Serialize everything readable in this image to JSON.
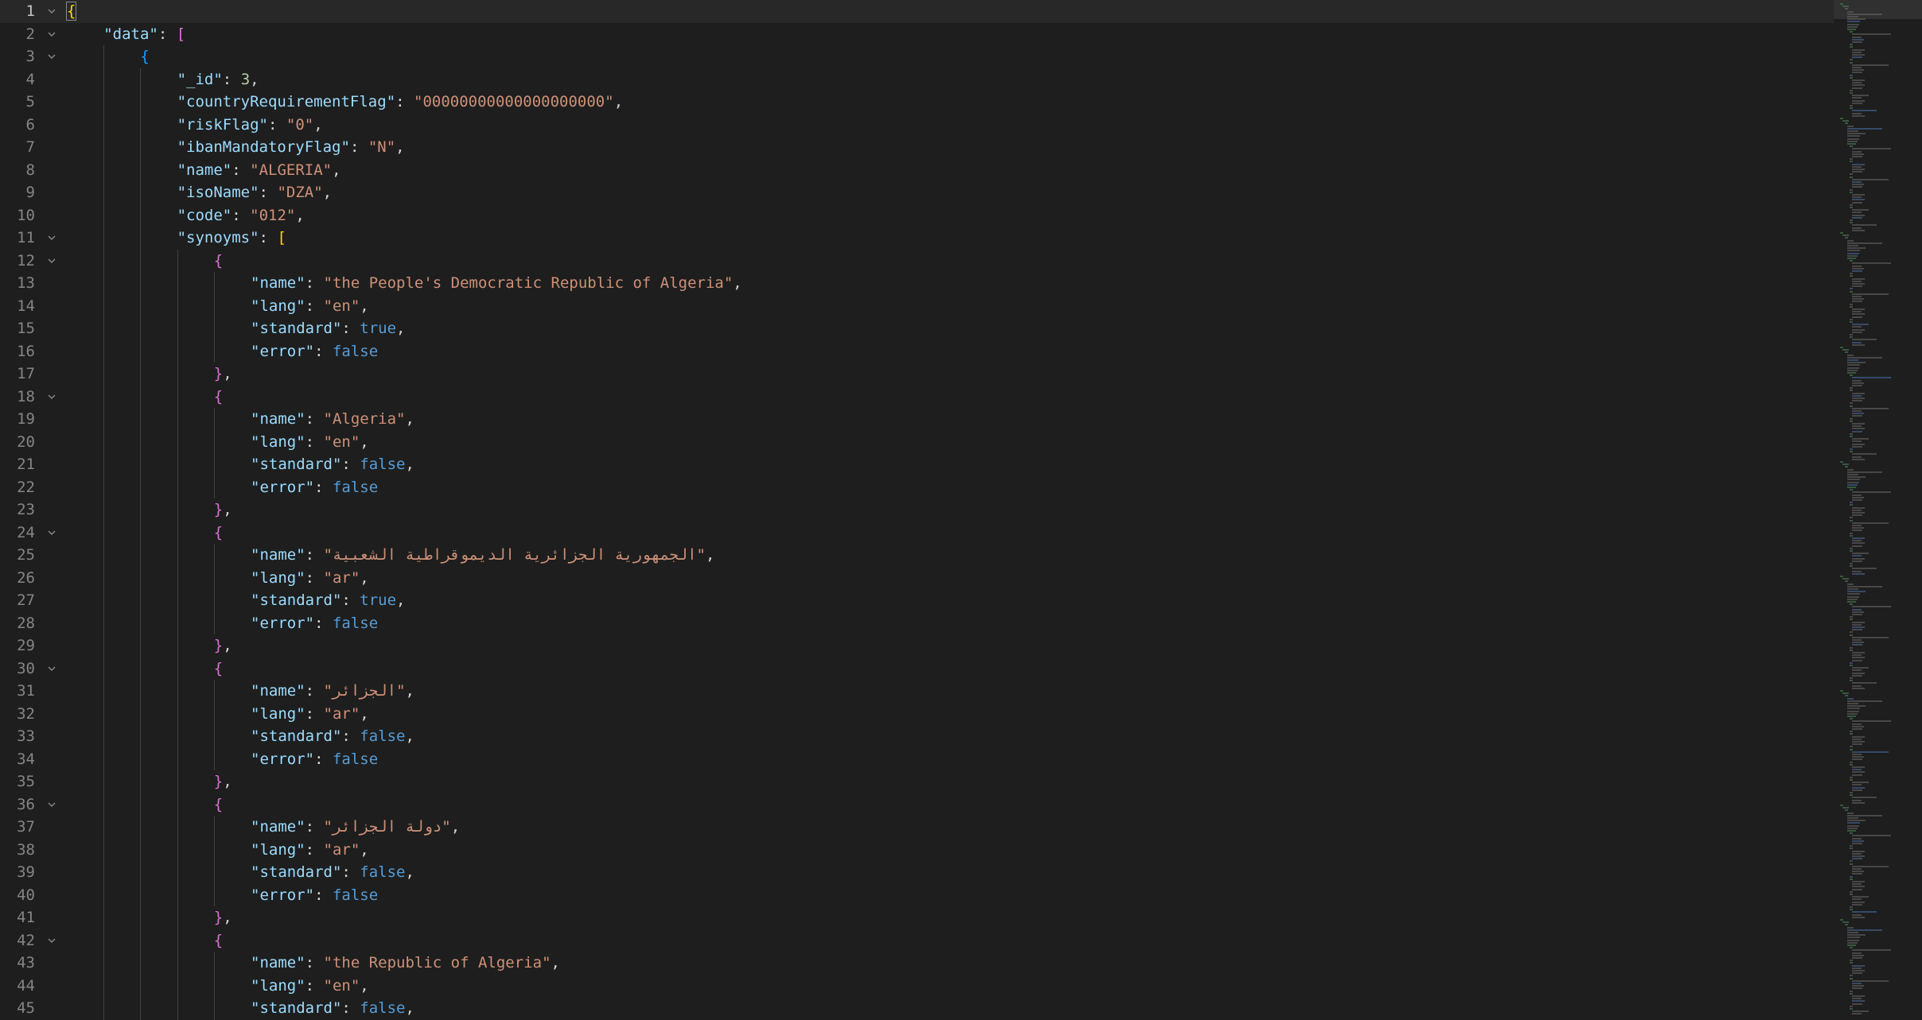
{
  "editor": {
    "lines": [
      {
        "n": "1",
        "indent": 0,
        "fold": true,
        "tokens": [
          {
            "t": "{",
            "c": "br1"
          }
        ]
      },
      {
        "n": "2",
        "indent": 1,
        "fold": true,
        "tokens": [
          {
            "t": "\"data\"",
            "c": "key"
          },
          {
            "t": ": ",
            "c": "p"
          },
          {
            "t": "[",
            "c": "br2"
          }
        ]
      },
      {
        "n": "3",
        "indent": 2,
        "fold": true,
        "tokens": [
          {
            "t": "{",
            "c": "br3"
          }
        ]
      },
      {
        "n": "4",
        "indent": 3,
        "fold": false,
        "tokens": [
          {
            "t": "\"_id\"",
            "c": "key"
          },
          {
            "t": ": ",
            "c": "p"
          },
          {
            "t": "3",
            "c": "n"
          },
          {
            "t": ",",
            "c": "p"
          }
        ]
      },
      {
        "n": "5",
        "indent": 3,
        "fold": false,
        "tokens": [
          {
            "t": "\"countryRequirementFlag\"",
            "c": "key"
          },
          {
            "t": ": ",
            "c": "p"
          },
          {
            "t": "\"00000000000000000000\"",
            "c": "str"
          },
          {
            "t": ",",
            "c": "p"
          }
        ]
      },
      {
        "n": "6",
        "indent": 3,
        "fold": false,
        "tokens": [
          {
            "t": "\"riskFlag\"",
            "c": "key"
          },
          {
            "t": ": ",
            "c": "p"
          },
          {
            "t": "\"0\"",
            "c": "str"
          },
          {
            "t": ",",
            "c": "p"
          }
        ]
      },
      {
        "n": "7",
        "indent": 3,
        "fold": false,
        "tokens": [
          {
            "t": "\"ibanMandatoryFlag\"",
            "c": "key"
          },
          {
            "t": ": ",
            "c": "p"
          },
          {
            "t": "\"N\"",
            "c": "str"
          },
          {
            "t": ",",
            "c": "p"
          }
        ]
      },
      {
        "n": "8",
        "indent": 3,
        "fold": false,
        "tokens": [
          {
            "t": "\"name\"",
            "c": "key"
          },
          {
            "t": ": ",
            "c": "p"
          },
          {
            "t": "\"ALGERIA\"",
            "c": "str"
          },
          {
            "t": ",",
            "c": "p"
          }
        ]
      },
      {
        "n": "9",
        "indent": 3,
        "fold": false,
        "tokens": [
          {
            "t": "\"isoName\"",
            "c": "key"
          },
          {
            "t": ": ",
            "c": "p"
          },
          {
            "t": "\"DZA\"",
            "c": "str"
          },
          {
            "t": ",",
            "c": "p"
          }
        ]
      },
      {
        "n": "10",
        "indent": 3,
        "fold": false,
        "tokens": [
          {
            "t": "\"code\"",
            "c": "key"
          },
          {
            "t": ": ",
            "c": "p"
          },
          {
            "t": "\"012\"",
            "c": "str"
          },
          {
            "t": ",",
            "c": "p"
          }
        ]
      },
      {
        "n": "11",
        "indent": 3,
        "fold": true,
        "tokens": [
          {
            "t": "\"synoyms\"",
            "c": "key"
          },
          {
            "t": ": ",
            "c": "p"
          },
          {
            "t": "[",
            "c": "br1"
          }
        ]
      },
      {
        "n": "12",
        "indent": 4,
        "fold": true,
        "tokens": [
          {
            "t": "{",
            "c": "br2"
          }
        ]
      },
      {
        "n": "13",
        "indent": 5,
        "fold": false,
        "tokens": [
          {
            "t": "\"name\"",
            "c": "key"
          },
          {
            "t": ": ",
            "c": "p"
          },
          {
            "t": "\"the People's Democratic Republic of Algeria\"",
            "c": "str"
          },
          {
            "t": ",",
            "c": "p"
          }
        ]
      },
      {
        "n": "14",
        "indent": 5,
        "fold": false,
        "tokens": [
          {
            "t": "\"lang\"",
            "c": "key"
          },
          {
            "t": ": ",
            "c": "p"
          },
          {
            "t": "\"en\"",
            "c": "str"
          },
          {
            "t": ",",
            "c": "p"
          }
        ]
      },
      {
        "n": "15",
        "indent": 5,
        "fold": false,
        "tokens": [
          {
            "t": "\"standard\"",
            "c": "key"
          },
          {
            "t": ": ",
            "c": "p"
          },
          {
            "t": "true",
            "c": "b"
          },
          {
            "t": ",",
            "c": "p"
          }
        ]
      },
      {
        "n": "16",
        "indent": 5,
        "fold": false,
        "tokens": [
          {
            "t": "\"error\"",
            "c": "key"
          },
          {
            "t": ": ",
            "c": "p"
          },
          {
            "t": "false",
            "c": "b"
          }
        ]
      },
      {
        "n": "17",
        "indent": 4,
        "fold": false,
        "tokens": [
          {
            "t": "}",
            "c": "br2"
          },
          {
            "t": ",",
            "c": "p"
          }
        ]
      },
      {
        "n": "18",
        "indent": 4,
        "fold": true,
        "tokens": [
          {
            "t": "{",
            "c": "br2"
          }
        ]
      },
      {
        "n": "19",
        "indent": 5,
        "fold": false,
        "tokens": [
          {
            "t": "\"name\"",
            "c": "key"
          },
          {
            "t": ": ",
            "c": "p"
          },
          {
            "t": "\"Algeria\"",
            "c": "str"
          },
          {
            "t": ",",
            "c": "p"
          }
        ]
      },
      {
        "n": "20",
        "indent": 5,
        "fold": false,
        "tokens": [
          {
            "t": "\"lang\"",
            "c": "key"
          },
          {
            "t": ": ",
            "c": "p"
          },
          {
            "t": "\"en\"",
            "c": "str"
          },
          {
            "t": ",",
            "c": "p"
          }
        ]
      },
      {
        "n": "21",
        "indent": 5,
        "fold": false,
        "tokens": [
          {
            "t": "\"standard\"",
            "c": "key"
          },
          {
            "t": ": ",
            "c": "p"
          },
          {
            "t": "false",
            "c": "b"
          },
          {
            "t": ",",
            "c": "p"
          }
        ]
      },
      {
        "n": "22",
        "indent": 5,
        "fold": false,
        "tokens": [
          {
            "t": "\"error\"",
            "c": "key"
          },
          {
            "t": ": ",
            "c": "p"
          },
          {
            "t": "false",
            "c": "b"
          }
        ]
      },
      {
        "n": "23",
        "indent": 4,
        "fold": false,
        "tokens": [
          {
            "t": "}",
            "c": "br2"
          },
          {
            "t": ",",
            "c": "p"
          }
        ]
      },
      {
        "n": "24",
        "indent": 4,
        "fold": true,
        "tokens": [
          {
            "t": "{",
            "c": "br2"
          }
        ]
      },
      {
        "n": "25",
        "indent": 5,
        "fold": false,
        "tokens": [
          {
            "t": "\"name\"",
            "c": "key"
          },
          {
            "t": ": ",
            "c": "p"
          },
          {
            "t": "\"الجمهورية الجزائرية الديموقراطية الشعبية\"",
            "c": "str"
          },
          {
            "t": ",",
            "c": "p"
          }
        ]
      },
      {
        "n": "26",
        "indent": 5,
        "fold": false,
        "tokens": [
          {
            "t": "\"lang\"",
            "c": "key"
          },
          {
            "t": ": ",
            "c": "p"
          },
          {
            "t": "\"ar\"",
            "c": "str"
          },
          {
            "t": ",",
            "c": "p"
          }
        ]
      },
      {
        "n": "27",
        "indent": 5,
        "fold": false,
        "tokens": [
          {
            "t": "\"standard\"",
            "c": "key"
          },
          {
            "t": ": ",
            "c": "p"
          },
          {
            "t": "true",
            "c": "b"
          },
          {
            "t": ",",
            "c": "p"
          }
        ]
      },
      {
        "n": "28",
        "indent": 5,
        "fold": false,
        "tokens": [
          {
            "t": "\"error\"",
            "c": "key"
          },
          {
            "t": ": ",
            "c": "p"
          },
          {
            "t": "false",
            "c": "b"
          }
        ]
      },
      {
        "n": "29",
        "indent": 4,
        "fold": false,
        "tokens": [
          {
            "t": "}",
            "c": "br2"
          },
          {
            "t": ",",
            "c": "p"
          }
        ]
      },
      {
        "n": "30",
        "indent": 4,
        "fold": true,
        "tokens": [
          {
            "t": "{",
            "c": "br2"
          }
        ]
      },
      {
        "n": "31",
        "indent": 5,
        "fold": false,
        "tokens": [
          {
            "t": "\"name\"",
            "c": "key"
          },
          {
            "t": ": ",
            "c": "p"
          },
          {
            "t": "\"الجزائر\"",
            "c": "str"
          },
          {
            "t": ",",
            "c": "p"
          }
        ]
      },
      {
        "n": "32",
        "indent": 5,
        "fold": false,
        "tokens": [
          {
            "t": "\"lang\"",
            "c": "key"
          },
          {
            "t": ": ",
            "c": "p"
          },
          {
            "t": "\"ar\"",
            "c": "str"
          },
          {
            "t": ",",
            "c": "p"
          }
        ]
      },
      {
        "n": "33",
        "indent": 5,
        "fold": false,
        "tokens": [
          {
            "t": "\"standard\"",
            "c": "key"
          },
          {
            "t": ": ",
            "c": "p"
          },
          {
            "t": "false",
            "c": "b"
          },
          {
            "t": ",",
            "c": "p"
          }
        ]
      },
      {
        "n": "34",
        "indent": 5,
        "fold": false,
        "tokens": [
          {
            "t": "\"error\"",
            "c": "key"
          },
          {
            "t": ": ",
            "c": "p"
          },
          {
            "t": "false",
            "c": "b"
          }
        ]
      },
      {
        "n": "35",
        "indent": 4,
        "fold": false,
        "tokens": [
          {
            "t": "}",
            "c": "br2"
          },
          {
            "t": ",",
            "c": "p"
          }
        ]
      },
      {
        "n": "36",
        "indent": 4,
        "fold": true,
        "tokens": [
          {
            "t": "{",
            "c": "br2"
          }
        ]
      },
      {
        "n": "37",
        "indent": 5,
        "fold": false,
        "tokens": [
          {
            "t": "\"name\"",
            "c": "key"
          },
          {
            "t": ": ",
            "c": "p"
          },
          {
            "t": "\"دولة الجزائر\"",
            "c": "str"
          },
          {
            "t": ",",
            "c": "p"
          }
        ]
      },
      {
        "n": "38",
        "indent": 5,
        "fold": false,
        "tokens": [
          {
            "t": "\"lang\"",
            "c": "key"
          },
          {
            "t": ": ",
            "c": "p"
          },
          {
            "t": "\"ar\"",
            "c": "str"
          },
          {
            "t": ",",
            "c": "p"
          }
        ]
      },
      {
        "n": "39",
        "indent": 5,
        "fold": false,
        "tokens": [
          {
            "t": "\"standard\"",
            "c": "key"
          },
          {
            "t": ": ",
            "c": "p"
          },
          {
            "t": "false",
            "c": "b"
          },
          {
            "t": ",",
            "c": "p"
          }
        ]
      },
      {
        "n": "40",
        "indent": 5,
        "fold": false,
        "tokens": [
          {
            "t": "\"error\"",
            "c": "key"
          },
          {
            "t": ": ",
            "c": "p"
          },
          {
            "t": "false",
            "c": "b"
          }
        ]
      },
      {
        "n": "41",
        "indent": 4,
        "fold": false,
        "tokens": [
          {
            "t": "}",
            "c": "br2"
          },
          {
            "t": ",",
            "c": "p"
          }
        ]
      },
      {
        "n": "42",
        "indent": 4,
        "fold": true,
        "tokens": [
          {
            "t": "{",
            "c": "br2"
          }
        ]
      },
      {
        "n": "43",
        "indent": 5,
        "fold": false,
        "tokens": [
          {
            "t": "\"name\"",
            "c": "key"
          },
          {
            "t": ": ",
            "c": "p"
          },
          {
            "t": "\"the Republic of Algeria\"",
            "c": "str"
          },
          {
            "t": ",",
            "c": "p"
          }
        ]
      },
      {
        "n": "44",
        "indent": 5,
        "fold": false,
        "tokens": [
          {
            "t": "\"lang\"",
            "c": "key"
          },
          {
            "t": ": ",
            "c": "p"
          },
          {
            "t": "\"en\"",
            "c": "str"
          },
          {
            "t": ",",
            "c": "p"
          }
        ]
      },
      {
        "n": "45",
        "indent": 5,
        "fold": false,
        "tokens": [
          {
            "t": "\"standard\"",
            "c": "key"
          },
          {
            "t": ": ",
            "c": "p"
          },
          {
            "t": "false",
            "c": "b"
          },
          {
            "t": ",",
            "c": "p"
          }
        ]
      }
    ]
  },
  "colors": {
    "background": "#1e1e1e",
    "key": "#9cdcfe",
    "string": "#ce9178",
    "number": "#b5cea8",
    "boolean": "#569cd6",
    "bracket_level1": "#ffd700",
    "bracket_level2": "#da70d6",
    "bracket_level3": "#179fff"
  },
  "icons": {
    "fold": "chevron-down-icon"
  }
}
